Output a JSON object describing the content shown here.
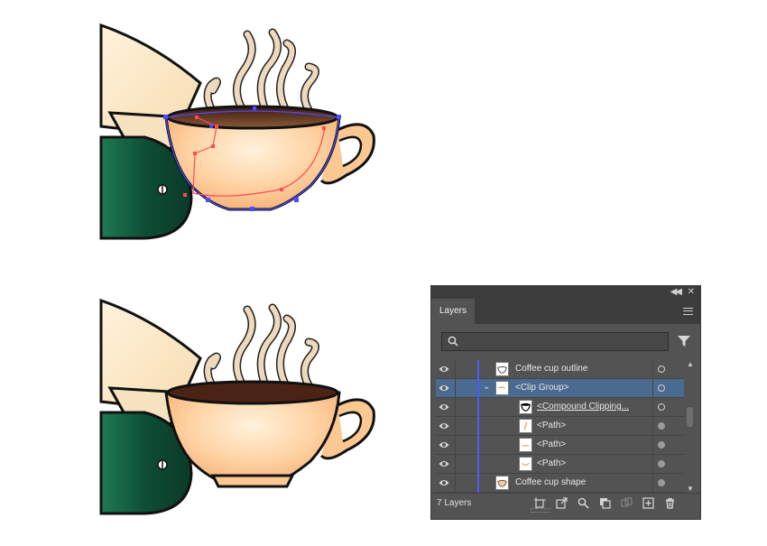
{
  "panel": {
    "tab_label": "Layers",
    "search": {
      "value": "",
      "placeholder": ""
    },
    "layers": [
      {
        "name": "Coffee cup outline",
        "indent": 0,
        "expanded": null,
        "selected": false,
        "target": "hollow",
        "underline": false,
        "thumb": "cup-outline"
      },
      {
        "name": "<Clip Group>",
        "indent": 0,
        "expanded": true,
        "selected": true,
        "target": "hollow",
        "underline": false,
        "thumb": "clip-group"
      },
      {
        "name": "<Compound Clipping...",
        "indent": 1,
        "expanded": null,
        "selected": false,
        "target": "hollow",
        "underline": true,
        "thumb": "compound"
      },
      {
        "name": "<Path>",
        "indent": 1,
        "expanded": null,
        "selected": false,
        "target": "filled",
        "underline": false,
        "thumb": "path-stroke"
      },
      {
        "name": "<Path>",
        "indent": 1,
        "expanded": null,
        "selected": false,
        "target": "filled",
        "underline": false,
        "thumb": "path-line"
      },
      {
        "name": "<Path>",
        "indent": 1,
        "expanded": null,
        "selected": false,
        "target": "filled",
        "underline": false,
        "thumb": "path-curve"
      },
      {
        "name": "Coffee cup shape",
        "indent": 0,
        "expanded": null,
        "selected": false,
        "target": "filled",
        "underline": false,
        "thumb": "cup-shape"
      }
    ],
    "footer": {
      "count_label": "7 Layers"
    }
  },
  "colors": {
    "panel_bg": "#535353",
    "selected_row": "#4b6a8f",
    "layer_color_bar": "#4a5cff",
    "cup_fill": "#fbc892",
    "coffee": "#5a2d1c",
    "steam": "#efd9bd",
    "filter_paper": "#fdebc8",
    "grinder_green": "#0f5139",
    "selection_blue": "#4b4bff",
    "selection_red": "#ff4b4b"
  }
}
